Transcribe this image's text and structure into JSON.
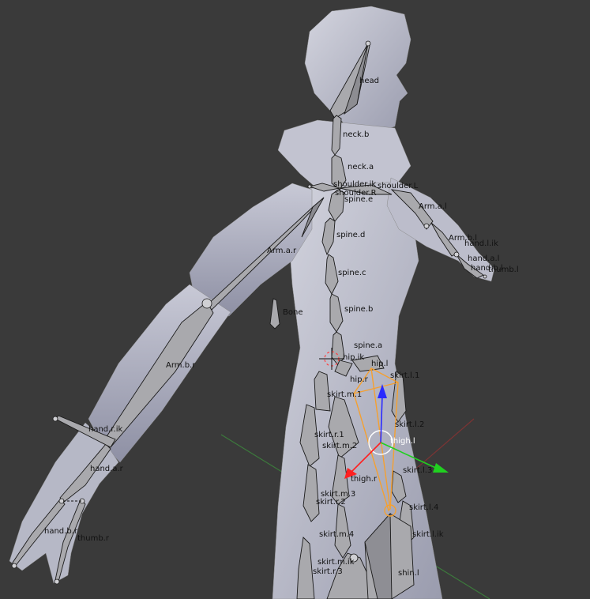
{
  "viewport": {
    "background": "#3a3a3a",
    "mesh_color": "#b8bac8",
    "bone_color": "#a8a8ac",
    "selected_color": "#f5a030",
    "axis_x_color": "#ff2020",
    "axis_y_color": "#20d020",
    "axis_z_color": "#2020ff"
  },
  "bones": {
    "head": "head",
    "neck_b": "neck.b",
    "neck_a": "neck.a",
    "shoulder_ik": "shoulder.ik",
    "shoulder_r": "shoulder.R",
    "shoulder_l": "shoulder.L",
    "spine_e": "spine.e",
    "spine_d": "spine.d",
    "spine_c": "spine.c",
    "spine_b": "spine.b",
    "spine_a": "spine.a",
    "arm_a_l": "Arm.a.l",
    "arm_b_l": "Arm.b.l",
    "hand_l_ik": "hand.l.ik",
    "hand_a_l": "hand.a.l",
    "hand_b_l": "hand.b.l",
    "thumb_l": "thumb.l",
    "arm_a_r": "Arm.a.r",
    "arm_b_r": "Arm.b.r",
    "hand_r_ik": "hand.r.ik",
    "hand_a_r": "hand.a.r",
    "hand_b_r": "hand.b.r",
    "thumb_r": "thumb.r",
    "bone": "Bone",
    "hip_r": "hip.r",
    "hip_l": "hip.l",
    "hip_ik": "hip.ik",
    "skirt_l_1": "skirt.l.1",
    "skirt_l_2": "skirt.l.2",
    "skirt_l_3": "skirt.l.3",
    "skirt_l_4": "skirt.l.4",
    "skirt_l_ik": "skirt.l.ik",
    "skirt_m_1": "skirt.m.1",
    "skirt_m_2": "skirt.m.2",
    "skirt_m_3": "skirt.m.3",
    "skirt_m_4": "skirt.m.4",
    "skirt_m_ik": "skirt.m.ik",
    "skirt_r_1": "skirt.r.1",
    "skirt_r_2": "skirt.r.2",
    "skirt_r_3": "skirt.r.3",
    "thigh_l": "thigh.l",
    "thigh_r": "thigh.r",
    "shin_l": "shin.l"
  }
}
